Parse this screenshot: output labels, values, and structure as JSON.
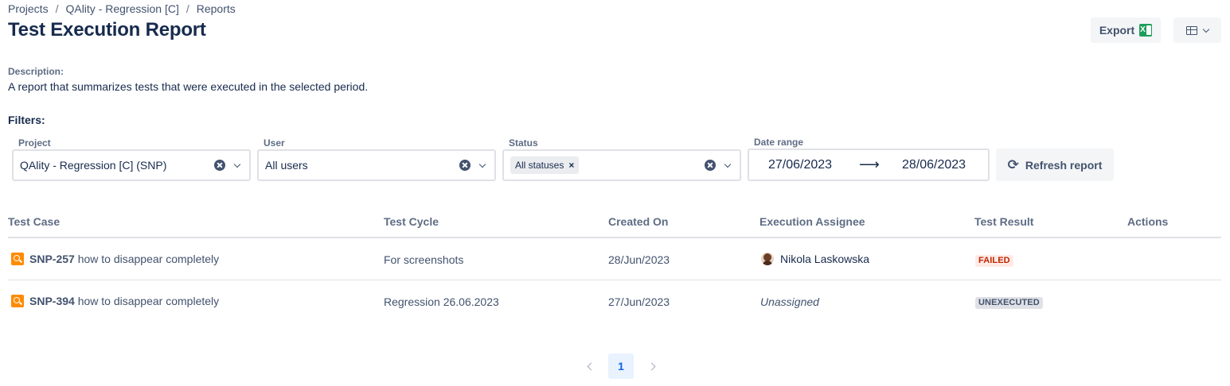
{
  "breadcrumb": [
    {
      "label": "Projects"
    },
    {
      "label": "QAlity - Regression [C]"
    },
    {
      "label": "Reports"
    }
  ],
  "breadcrumb_separator": "/",
  "page_title": "Test Execution Report",
  "toolbar": {
    "export_label": "Export",
    "export_icon": "excel-icon",
    "view_icon": "table-icon"
  },
  "description": {
    "label": "Description:",
    "text": "A report that summarizes tests that were executed in the selected period."
  },
  "filters": {
    "label": "Filters:",
    "project": {
      "label": "Project",
      "value": "QAlity - Regression [C] (SNP)"
    },
    "user": {
      "label": "User",
      "value": "All users"
    },
    "status": {
      "label": "Status",
      "tag": "All statuses",
      "tag_remove": "×"
    },
    "date_range": {
      "label": "Date range",
      "from": "27/06/2023",
      "arrow": "⟶",
      "to": "28/06/2023"
    },
    "refresh_label": "Refresh report",
    "refresh_icon": "⟳"
  },
  "table": {
    "columns": [
      "Test Case",
      "Test Cycle",
      "Created On",
      "Execution Assignee",
      "Test Result",
      "Actions"
    ],
    "rows": [
      {
        "key": "SNP-257",
        "summary": "how to disappear completely",
        "cycle": "For screenshots",
        "created": "28/Jun/2023",
        "assignee": "Nikola Laskowska",
        "assigned": true,
        "result": "FAILED"
      },
      {
        "key": "SNP-394",
        "summary": "how to disappear completely",
        "cycle": "Regression 26.06.2023",
        "created": "27/Jun/2023",
        "assignee": "Unassigned",
        "assigned": false,
        "result": "UNEXECUTED"
      }
    ]
  },
  "pagination": {
    "current_page": "1"
  },
  "colors": {
    "failed": "#bf2600",
    "unexecuted": "#42526e",
    "test_icon": "#ff8b00",
    "current_page": "#0c66e4"
  }
}
